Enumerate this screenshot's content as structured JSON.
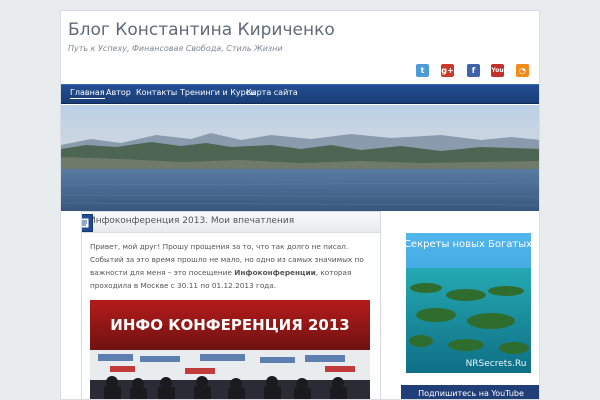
{
  "site": {
    "title": "Блог Константина Кириченко",
    "tagline": "Путь к Успеху, Финансовая Свобода, Стиль Жизни"
  },
  "social": [
    {
      "name": "twitter-icon",
      "label": "t",
      "color": "#4a9bd6"
    },
    {
      "name": "google-plus-icon",
      "label": "g+",
      "color": "#c93a2d"
    },
    {
      "name": "facebook-icon",
      "label": "f",
      "color": "#3f62a8"
    },
    {
      "name": "youtube-icon",
      "label": "You",
      "color": "#c4302b"
    },
    {
      "name": "rss-icon",
      "label": "◔",
      "color": "#f08b1c"
    }
  ],
  "nav": [
    "Главная",
    "Автор",
    "Контакты",
    "Тренинги и Курсы",
    "Карта сайта"
  ],
  "post": {
    "title": "Инфоконференция 2013. Мои впечатления",
    "body_part1": "Привет, мой друг! Прошу прощения за то, что так долго не писал. Событий за это время прошло не мало, но одно из самых значимых по важности для меня – это посещение ",
    "body_bold": "Инфоконференции",
    "body_part2": ", которая проходила в Москве с 30.11 по 01.12.2013 года.",
    "image_text": "ИНФО КОНФЕРЕНЦИЯ 2013"
  },
  "sidebar": {
    "ad_title": "Секреты новых Богатых",
    "ad_url": "NRSecrets.Ru",
    "subscribe": "Подпишитесь на YouTube"
  },
  "colors": {
    "nav": "#234f92",
    "sea": "#4a6a91",
    "sky": "#c7d5e2"
  }
}
